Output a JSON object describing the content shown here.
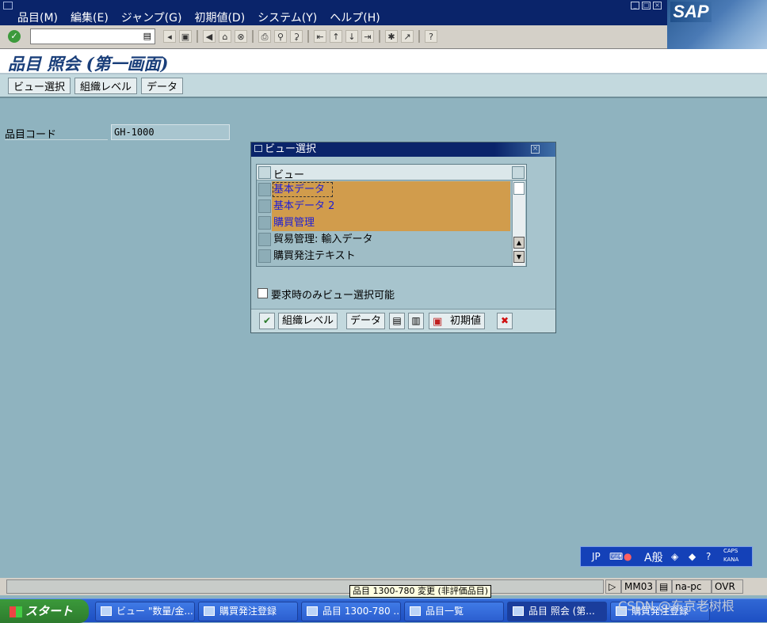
{
  "menubar": {
    "items": [
      "品目(M)",
      "編集(E)",
      "ジャンプ(G)",
      "初期値(D)",
      "システム(Y)",
      "ヘルプ(H)"
    ],
    "logo_text": "SAP"
  },
  "toolbar": {
    "command_field_value": "",
    "icons": [
      "enter-icon",
      "save-icon",
      "back-icon",
      "exit-icon",
      "cancel-icon",
      "print-icon",
      "find-icon",
      "find-next-icon",
      "first-page-icon",
      "previous-page-icon",
      "next-page-icon",
      "last-page-icon",
      "new-session-icon",
      "shortcut-icon",
      "help-icon"
    ]
  },
  "title": "品目 照会 (第一画面)",
  "app_toolbar": {
    "buttons": [
      "ビュー選択",
      "組織レベル",
      "データ"
    ]
  },
  "main": {
    "field_label": "品目コード",
    "field_value": "GH-1000"
  },
  "dialog": {
    "title": "ビュー選択",
    "column_header": "ビュー",
    "rows": [
      {
        "label": "基本データ 1",
        "selected": true
      },
      {
        "label": "基本データ 2",
        "selected": true
      },
      {
        "label": "購買管理",
        "selected": true
      },
      {
        "label": "貿易管理: 輸入データ",
        "selected": false
      },
      {
        "label": "購買発注テキスト",
        "selected": false
      }
    ],
    "checkbox_label": "要求時のみビュー選択可能",
    "buttons": {
      "org_level": "組織レベル",
      "data": "データ",
      "defaults": "初期値"
    },
    "selection_color": "#d19c4c"
  },
  "status": {
    "message": "",
    "transaction": "MM03",
    "server": "na-pc",
    "mode": "OVR",
    "tooltip": "品目 1300-780 変更 (非評価品目)"
  },
  "system_tray": {
    "lang": "JP",
    "ime": "A般",
    "caps": "CAPS",
    "kana": "KANA"
  },
  "taskbar": {
    "start": "スタート",
    "items": [
      {
        "label": "ビュー \"数量/金...",
        "active": false
      },
      {
        "label": "購買発注登録",
        "active": false
      },
      {
        "label": "品目 1300-780 ...",
        "active": false
      },
      {
        "label": "品目一覧",
        "active": false
      },
      {
        "label": "品目 照会 (第...",
        "active": true
      },
      {
        "label": "購買発注登録",
        "active": false
      }
    ]
  },
  "watermark": "CSDN @东京老树根"
}
